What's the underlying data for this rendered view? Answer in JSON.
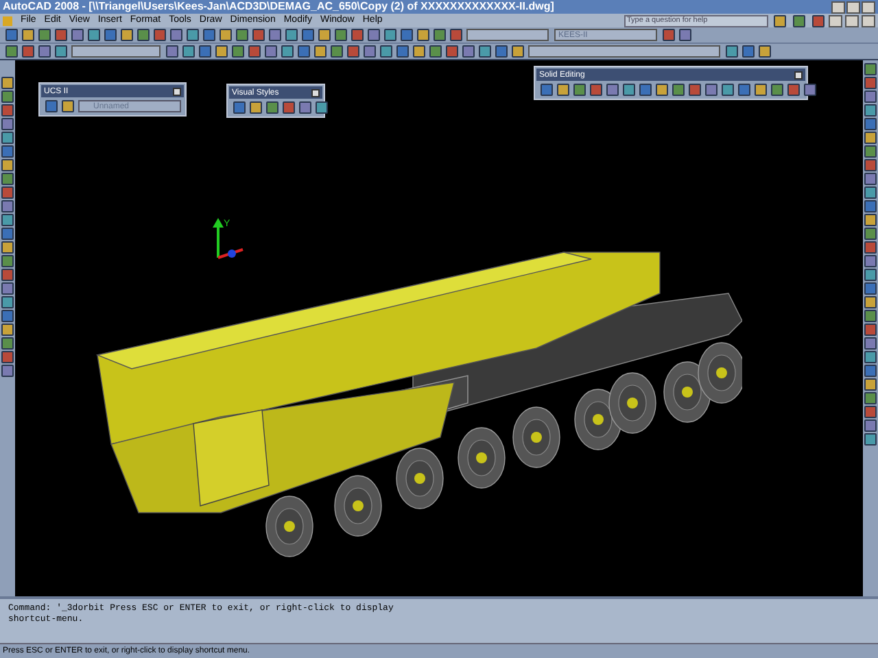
{
  "window": {
    "title": "AutoCAD 2008 - [\\\\Triangel\\Users\\Kees-Jan\\ACD3D\\DEMAG_AC_650\\Copy (2) of XXXXXXXXXXXXX-II.dwg]"
  },
  "menu": [
    "File",
    "Edit",
    "View",
    "Insert",
    "Format",
    "Tools",
    "Draw",
    "Dimension",
    "Modify",
    "Window",
    "Help"
  ],
  "help_search": {
    "placeholder": "Type a question for help"
  },
  "layer_dropdown": {
    "value": "KEES-II"
  },
  "floating_toolbars": [
    {
      "title": "UCS II",
      "dropdown": "Unnamed"
    },
    {
      "title": "Visual Styles"
    },
    {
      "title": "Solid Editing"
    }
  ],
  "viewport": {
    "ucs_axis_label": "Y"
  },
  "command_line": {
    "lines": [
      "Command: '_3dorbit Press ESC or ENTER to exit, or right-click to display",
      "shortcut-menu."
    ]
  },
  "status_bar": {
    "text": "Press ESC or ENTER to exit, or right-click to display shortcut menu."
  }
}
